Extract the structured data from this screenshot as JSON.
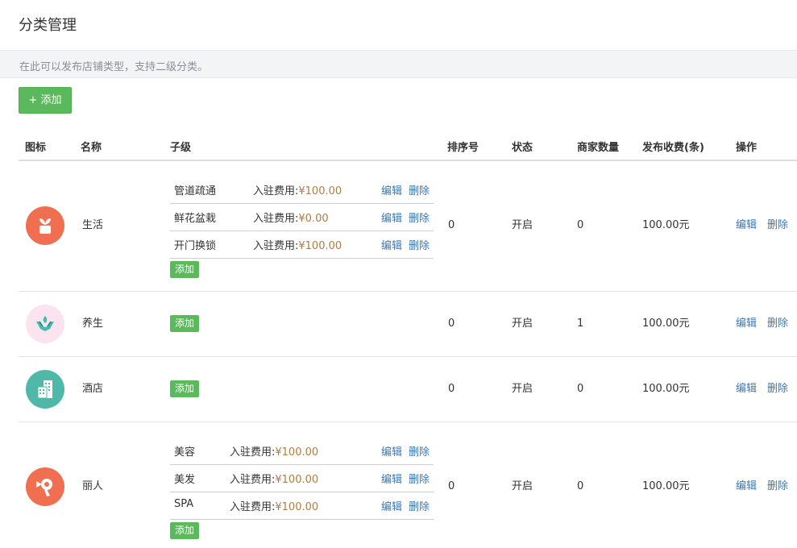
{
  "page": {
    "title": "分类管理",
    "tip": "在此可以发布店铺类型，支持二级分类。",
    "add_label": "+ 添加"
  },
  "table": {
    "headers": [
      "图标",
      "名称",
      "子级",
      "排序号",
      "状态",
      "商家数量",
      "发布收费(条)",
      "操作"
    ],
    "sub_add_label": "添加",
    "edit_label": "编辑",
    "delete_label": "删除",
    "fee_prefix": "入驻费用:",
    "rows": [
      {
        "icon": "plant-pot-icon",
        "icon_color": "#ef6f50",
        "name": "生活",
        "children": [
          {
            "name": "管道疏通",
            "fee": "¥100.00"
          },
          {
            "name": "鲜花盆栽",
            "fee": "¥0.00"
          },
          {
            "name": "开门换锁",
            "fee": "¥100.00"
          }
        ],
        "sort": "0",
        "status": "开启",
        "merchant_count": "0",
        "fee": "100.00元"
      },
      {
        "icon": "wellness-hands-icon",
        "icon_color": "#fbe3ef",
        "name": "养生",
        "children": [],
        "sort": "0",
        "status": "开启",
        "merchant_count": "1",
        "fee": "100.00元"
      },
      {
        "icon": "hotel-building-icon",
        "icon_color": "#4fb8a9",
        "name": "酒店",
        "children": [],
        "sort": "0",
        "status": "开启",
        "merchant_count": "0",
        "fee": "100.00元"
      },
      {
        "icon": "hair-dryer-icon",
        "icon_color": "#ef6f50",
        "name": "丽人",
        "children": [
          {
            "name": "美容",
            "fee": "¥100.00"
          },
          {
            "name": "美发",
            "fee": "¥100.00"
          },
          {
            "name": "SPA",
            "fee": "¥100.00"
          }
        ],
        "sort": "0",
        "status": "开启",
        "merchant_count": "0",
        "fee": "100.00元"
      }
    ]
  },
  "colors": {
    "primary_green": "#5cb85c",
    "link_blue": "#3d78b2",
    "fee_amount": "#b07c3e"
  }
}
